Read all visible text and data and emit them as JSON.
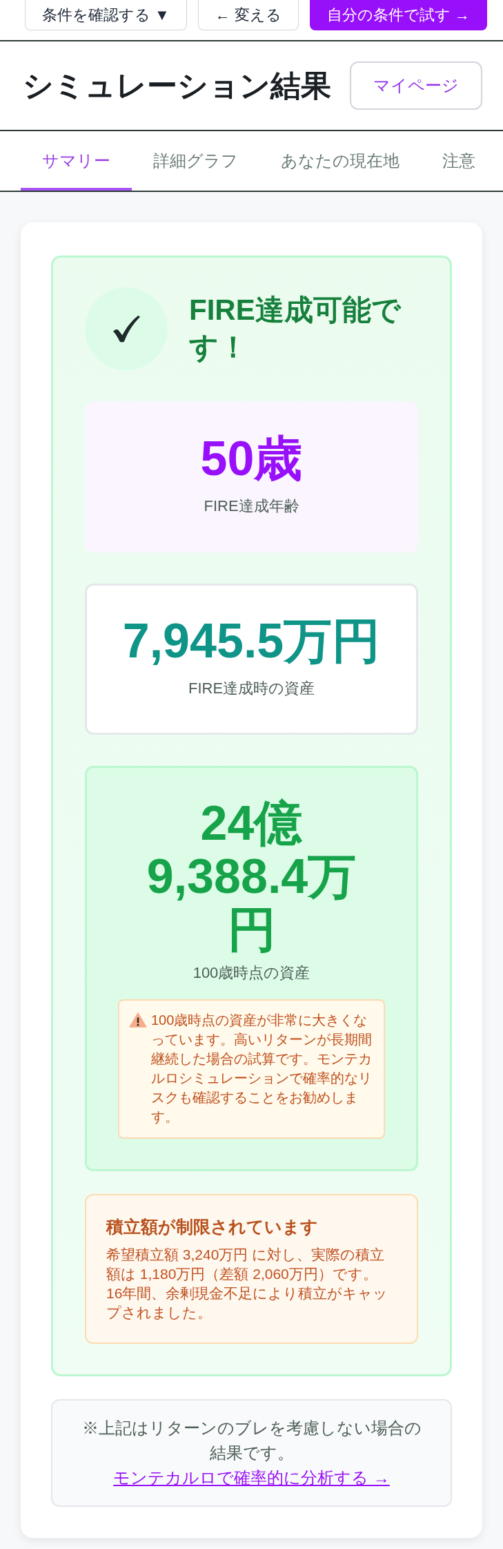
{
  "top_bar": {
    "buttons": [
      {
        "label": "条件を確認する ▼",
        "kind": "outline"
      },
      {
        "label": "← 変える",
        "kind": "outline"
      },
      {
        "label": "自分の条件で試す →",
        "kind": "primary"
      }
    ]
  },
  "header": {
    "title": "シミュレーション結果",
    "mypage_button": "マイページ"
  },
  "tabs": [
    {
      "label": "サマリー",
      "selected": true
    },
    {
      "label": "詳細グラフ",
      "selected": false
    },
    {
      "label": "あなたの現在地",
      "selected": false
    },
    {
      "label": "注意",
      "selected": false
    }
  ],
  "result": {
    "status": "FIRE達成可能です！",
    "metrics": [
      {
        "kind": "age",
        "value": "50歳",
        "label": "FIRE達成年齢"
      },
      {
        "kind": "asset",
        "value": "7,945.5万円",
        "label": "FIRE達成時の資産"
      },
      {
        "kind": "final",
        "value": "24億9,388.4万円",
        "label": "100歳時点の資産",
        "warning": "100歳時点の資産が非常に大きくなっています。高いリターンが長期間継続した場合の試算です。モンテカルロシミュレーションで確率的なリスクも確認することをお勧めします。"
      }
    ],
    "notice": {
      "title": "積立額が制限されています",
      "text": "希望積立額 3,240万円 に対し、実際の積立額は 1,180万円（差額 2,060万円）です。16年間、余剰現金不足により積立がキャップされました。"
    }
  },
  "footer_note": {
    "text": "※上記はリターンのブレを考慮しない場合の結果です。",
    "link": "モンテカルロで確率的に分析する →"
  }
}
